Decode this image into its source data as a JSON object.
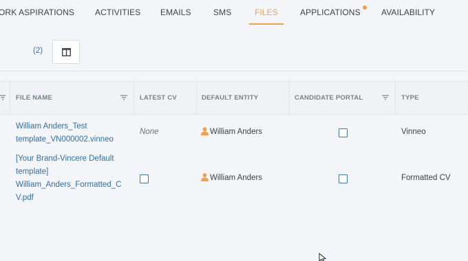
{
  "tabs": [
    {
      "label": "ORK ASPIRATIONS"
    },
    {
      "label": "ACTIVITIES"
    },
    {
      "label": "EMAILS"
    },
    {
      "label": "SMS"
    },
    {
      "label": "FILES",
      "active": true
    },
    {
      "label": "APPLICATIONS",
      "has_notification": true
    },
    {
      "label": "AVAILABILITY"
    }
  ],
  "toolbar": {
    "count": "(2)",
    "column_toggle_icon": "columns-icon"
  },
  "table": {
    "columns": [
      {
        "label": "FILE NAME",
        "filterable": true
      },
      {
        "label": "LATEST CV",
        "filterable": false
      },
      {
        "label": "DEFAULT ENTITY",
        "filterable": false
      },
      {
        "label": "CANDIDATE PORTAL",
        "filterable": true
      },
      {
        "label": "TYPE",
        "filterable": false
      }
    ],
    "rows": [
      {
        "file_name_lines": [
          "William Anders_Test",
          "template_VN000002.vinneo"
        ],
        "latest_cv": "None",
        "default_entity": "William Anders",
        "candidate_portal": false,
        "type": "Vinneo"
      },
      {
        "file_name_lines": [
          "[Your Brand-Vincere Default",
          "template]",
          "William_Anders_Formatted_C",
          "V.pdf"
        ],
        "latest_cv": false,
        "default_entity": "William Anders",
        "candidate_portal": false,
        "type": "Formatted CV"
      }
    ]
  },
  "colors": {
    "accent": "#f0a046",
    "link": "#2a6fb0",
    "checkbox_border": "#3a78b8",
    "header_text": "#7a7f89"
  }
}
